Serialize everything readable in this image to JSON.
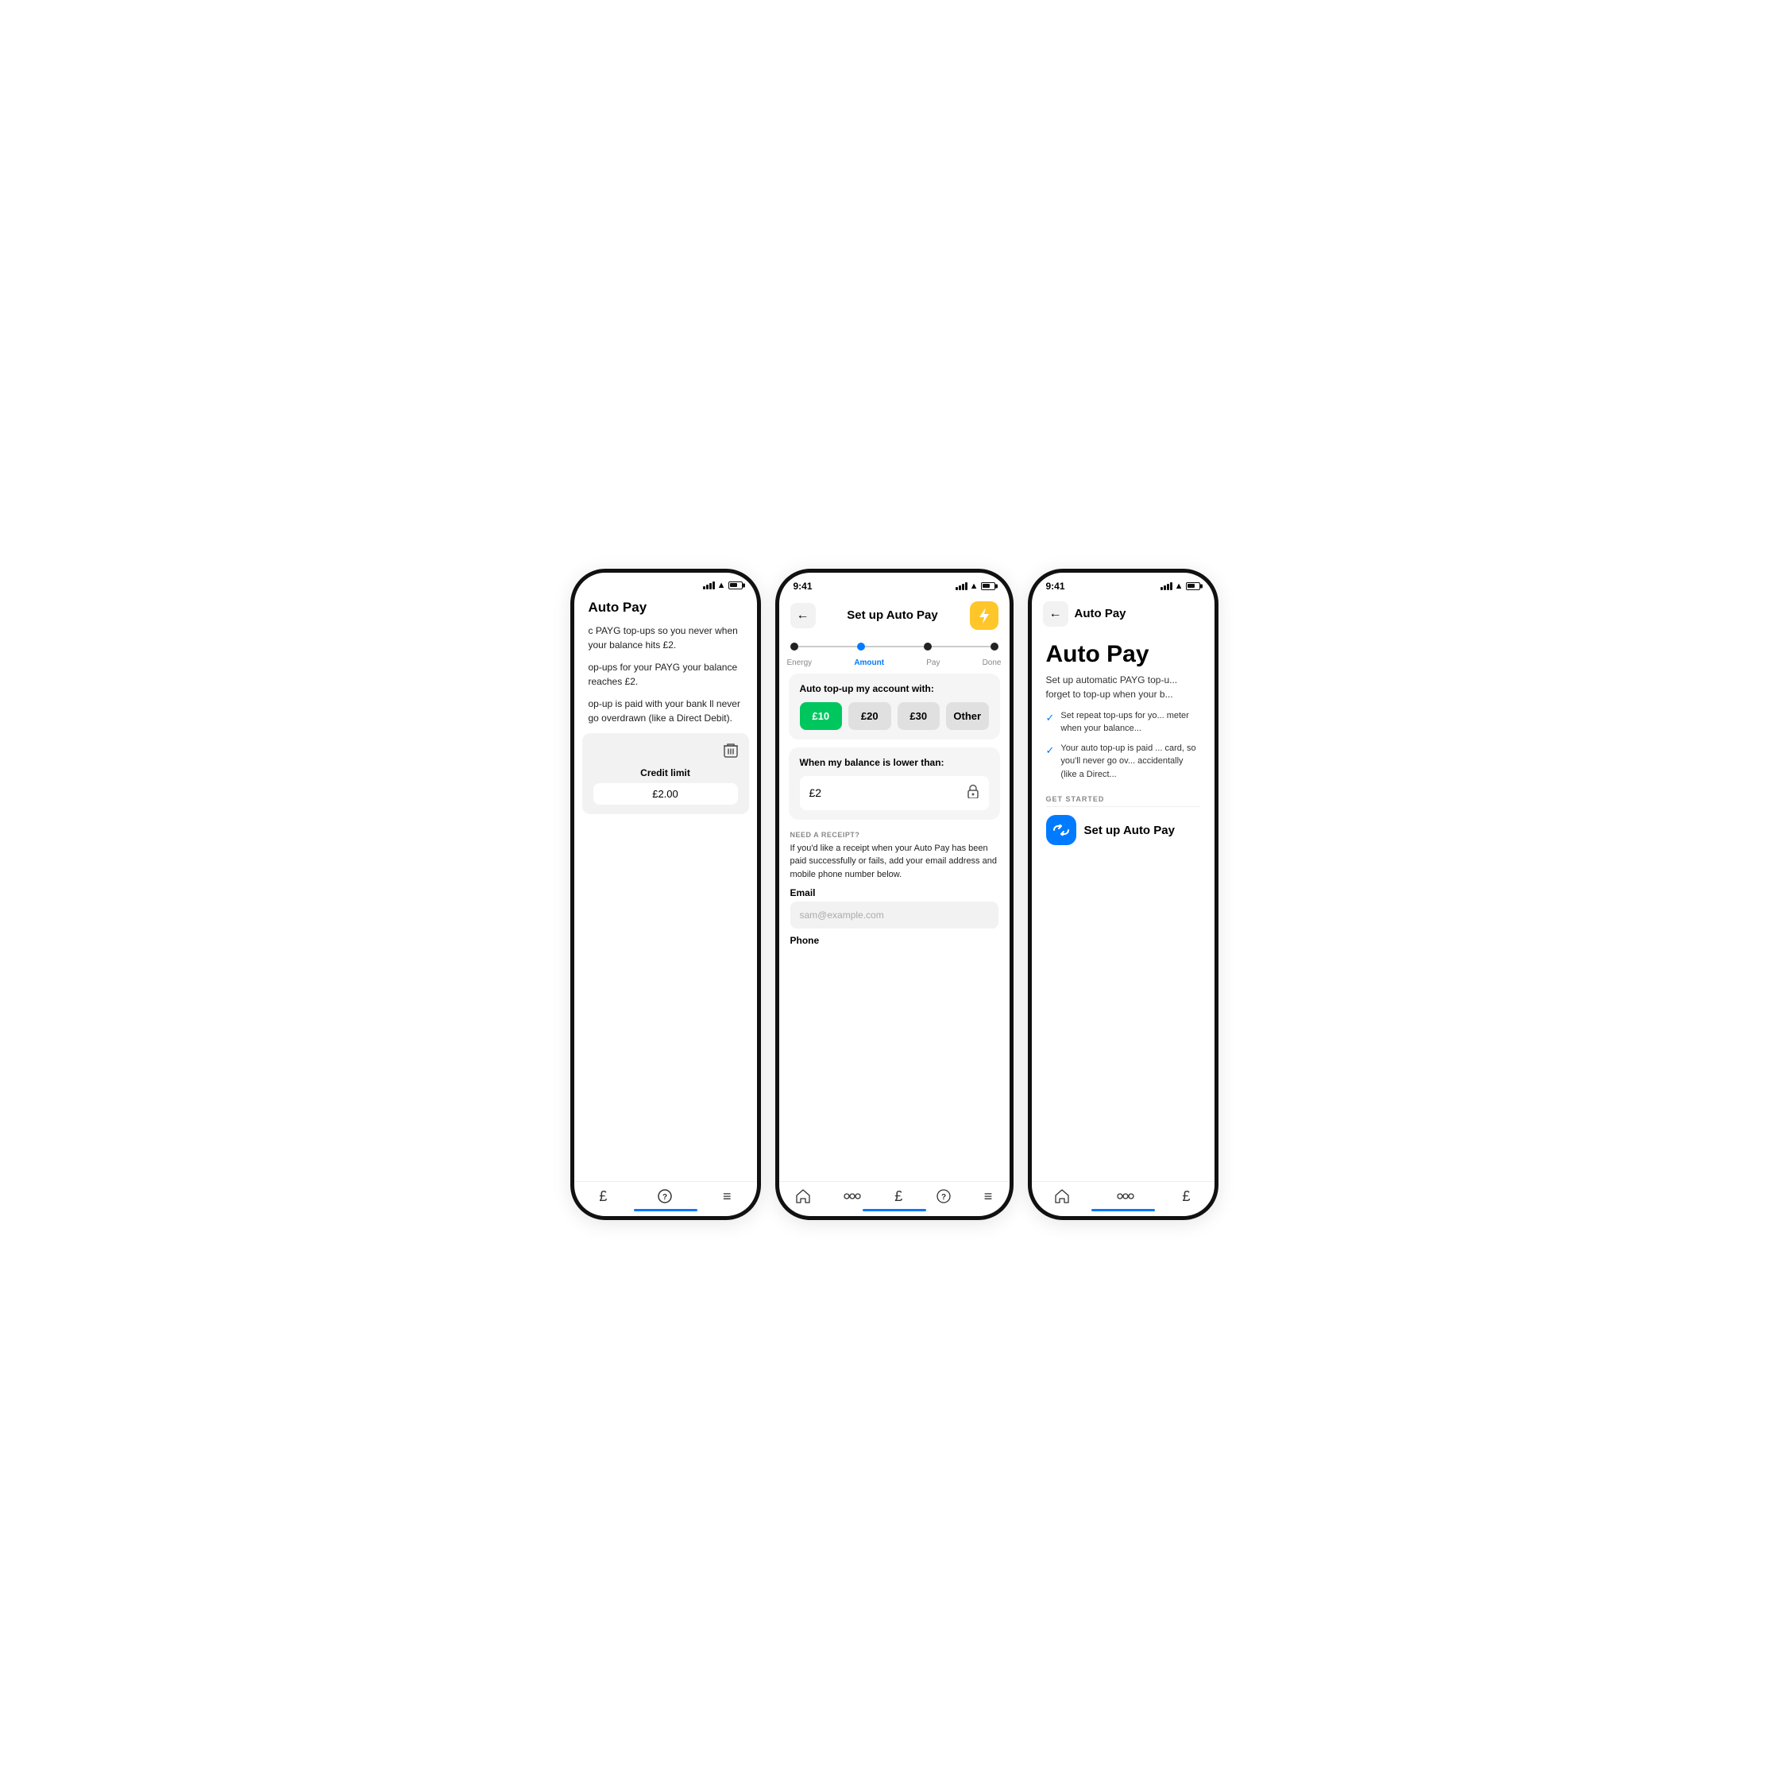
{
  "left": {
    "status_bar": {
      "show": false
    },
    "title": "Auto Pay",
    "body1": "c PAYG top-ups so you never when your balance hits £2.",
    "body2": "op-ups for your PAYG your balance reaches £2.",
    "body3": "op-up is paid with your bank ll never go overdrawn (like a Direct Debit).",
    "credit_card": {
      "label": "Credit limit",
      "value": "£2.00"
    },
    "nav": [
      "£",
      "?",
      "≡"
    ]
  },
  "center": {
    "time": "9:41",
    "header_title": "Set up Auto Pay",
    "back_label": "←",
    "lightning_icon": "⚡",
    "steps": [
      {
        "label": "Energy",
        "active": false
      },
      {
        "label": "Amount",
        "active": true
      },
      {
        "label": "Pay",
        "active": false
      },
      {
        "label": "Done",
        "active": false
      }
    ],
    "topup_card": {
      "title": "Auto top-up my account with:",
      "options": [
        "£10",
        "£20",
        "£30",
        "Other"
      ],
      "selected": "£10"
    },
    "balance_card": {
      "title": "When my balance is lower than:",
      "value": "£2"
    },
    "receipt_section": {
      "label": "NEED A RECEIPT?",
      "description": "If you'd like a receipt when your Auto Pay has been paid successfully or fails, add your email address and mobile phone number below.",
      "email_label": "Email",
      "email_placeholder": "sam@example.com",
      "phone_label": "Phone"
    },
    "nav": [
      "🏠",
      "⬡",
      "£",
      "?",
      "≡"
    ]
  },
  "right": {
    "time": "9:41",
    "header_title": "Auto Pay",
    "back_label": "←",
    "big_title": "Auto Pay",
    "description": "Set up automatic PAYG top-u... forget to top-up when your b...",
    "checklist": [
      "Set repeat top-ups for yo... meter when your balance...",
      "Your auto top-up is paid ... card, so you'll never go ov... accidentally (like a Direct..."
    ],
    "get_started_label": "GET STARTED",
    "setup_btn_label": "Set up Auto Pay",
    "loop_icon": "∞",
    "nav": [
      "🏠",
      "⬡",
      "£"
    ]
  }
}
